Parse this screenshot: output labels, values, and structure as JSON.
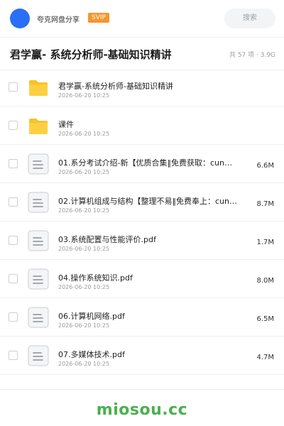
{
  "header": {
    "user_name": "夸克网盘分享",
    "badge": "SVIP",
    "search_placeholder": "搜索"
  },
  "title": {
    "text": "君学赢- 系统分析师-基础知识精讲",
    "summary": "共 57 项 · 3.9G"
  },
  "files": [
    {
      "type": "folder",
      "name": "君学赢-系统分析师-基础知识精讲",
      "date": "2026-06-20 10:25",
      "size": ""
    },
    {
      "type": "folder",
      "name": "课件",
      "date": "2026-06-20 10:25",
      "size": ""
    },
    {
      "type": "file",
      "name": "01.系分考试介绍-新【优质合集‖免费获取：cun…",
      "date": "2026-06-20 10:25",
      "size": "6.6M"
    },
    {
      "type": "file",
      "name": "02.计算机组成与结构【整理不易‖免费奉上：cun…",
      "date": "2026-06-20 10:25",
      "size": "8.7M"
    },
    {
      "type": "file",
      "name": "03.系统配置与性能评价.pdf",
      "date": "2026-06-20 10:25",
      "size": "1.7M"
    },
    {
      "type": "file",
      "name": "04.操作系统知识.pdf",
      "date": "2026-06-20 10:25",
      "size": "8.0M"
    },
    {
      "type": "file",
      "name": "06.计算机网络.pdf",
      "date": "2026-06-20 10:25",
      "size": "6.5M"
    },
    {
      "type": "file",
      "name": "07.多媒体技术.pdf",
      "date": "2026-06-20 10:25",
      "size": "4.7M"
    }
  ],
  "footer": {
    "watermark": "miosou.cc"
  },
  "colors": {
    "avatar": "#2a6ff6",
    "badge": "#f6962c",
    "folder": "#f7c325",
    "watermark": "#4caf50"
  }
}
